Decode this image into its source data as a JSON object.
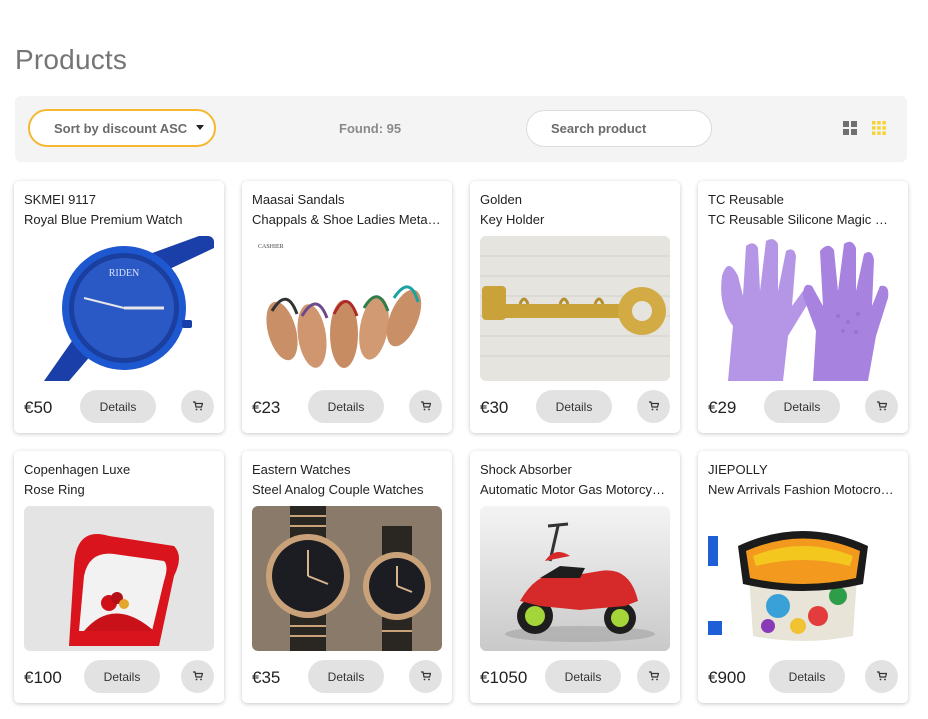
{
  "page": {
    "title": "Products"
  },
  "toolbar": {
    "sort_label": "Sort by discount ASC",
    "found_text": "Found: 95",
    "search_placeholder": "Search product",
    "view_active_color": "#f5d43a"
  },
  "products": [
    {
      "brand": "SKMEI 9117",
      "name": "Royal Blue Premium Watch",
      "price": "€50",
      "details_label": "Details",
      "image": "watch-image"
    },
    {
      "brand": "Maasai Sandals",
      "name": "Chappals & Shoe Ladies Metallic",
      "price": "€23",
      "details_label": "Details",
      "image": "sandals-image"
    },
    {
      "brand": "Golden",
      "name": "Key Holder",
      "price": "€30",
      "details_label": "Details",
      "image": "key-holder-image"
    },
    {
      "brand": "TC Reusable",
      "name": "TC Reusable Silicone Magic Washing Gloves",
      "price": "€29",
      "details_label": "Details",
      "image": "gloves-image"
    },
    {
      "brand": "Copenhagen Luxe",
      "name": "Rose Ring",
      "price": "€100",
      "details_label": "Details",
      "image": "ring-image"
    },
    {
      "brand": "Eastern Watches",
      "name": "Steel Analog Couple Watches",
      "price": "€35",
      "details_label": "Details",
      "image": "couple-watches-image"
    },
    {
      "brand": "Shock Absorber",
      "name": "Automatic Motor Gas Motorcycles",
      "price": "€1050",
      "details_label": "Details",
      "image": "motorcycle-image"
    },
    {
      "brand": "JIEPOLLY",
      "name": "New Arrivals Fashion Motocross Goggles",
      "price": "€900",
      "details_label": "Details",
      "image": "goggles-image"
    }
  ]
}
